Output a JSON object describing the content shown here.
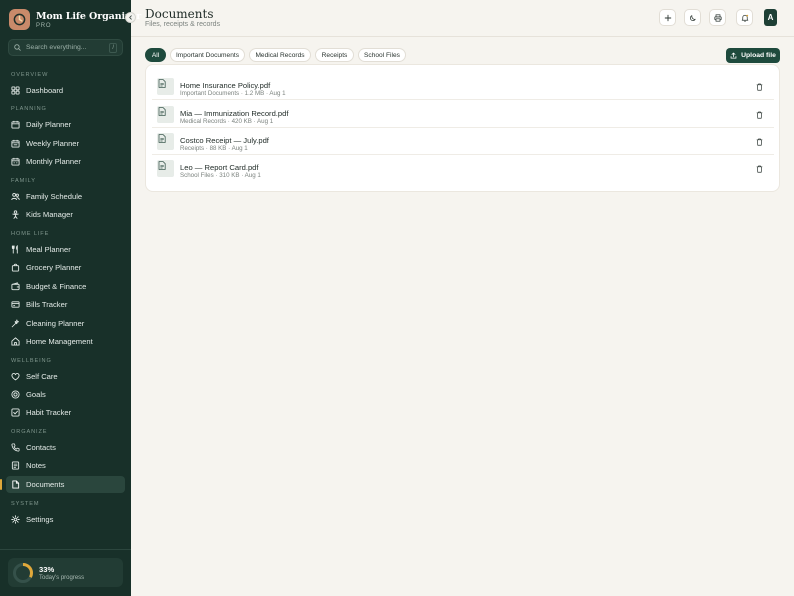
{
  "sidebar": {
    "brand_name": "Mom Life Organizer",
    "brand_tag": "PRO",
    "search_placeholder": "Search everything...",
    "search_shortcut": "/",
    "sections": {
      "overview": "OVERVIEW",
      "planning": "PLANNING",
      "family": "FAMILY",
      "home_life": "HOME LIFE",
      "wellbeing": "WELLBEING",
      "organize": "ORGANIZE",
      "system": "SYSTEM"
    },
    "items": {
      "dashboard": "Dashboard",
      "daily_planner": "Daily Planner",
      "weekly_planner": "Weekly Planner",
      "monthly_planner": "Monthly Planner",
      "family_schedule": "Family Schedule",
      "kids_manager": "Kids Manager",
      "meal_planner": "Meal Planner",
      "grocery_planner": "Grocery Planner",
      "budget_finance": "Budget & Finance",
      "bills_tracker": "Bills Tracker",
      "cleaning_planner": "Cleaning Planner",
      "home_management": "Home Management",
      "self_care": "Self Care",
      "goals": "Goals",
      "habit_tracker": "Habit Tracker",
      "contacts": "Contacts",
      "notes": "Notes",
      "documents": "Documents",
      "settings": "Settings"
    },
    "active_item": "documents",
    "progress": {
      "value": "33%",
      "fraction": 0.33,
      "label": "Today's progress"
    }
  },
  "header": {
    "title": "Documents",
    "subtitle": "Files, receipts & records",
    "avatar_initial": "A"
  },
  "tabs": [
    "All",
    "Important Documents",
    "Medical Records",
    "Receipts",
    "School Files"
  ],
  "active_tab": "All",
  "upload_label": "Upload file",
  "documents": [
    {
      "name": "Home Insurance Policy.pdf",
      "meta": "Important Documents · 1.2 MB · Aug 1"
    },
    {
      "name": "Mia — Immunization Record.pdf",
      "meta": "Medical Records · 420 KB · Aug 1"
    },
    {
      "name": "Costco Receipt — July.pdf",
      "meta": "Receipts · 88 KB · Aug 1"
    },
    {
      "name": "Leo — Report Card.pdf",
      "meta": "School Files · 310 KB · Aug 1"
    }
  ],
  "colors": {
    "sidebar_bg": "#183029",
    "accent": "#1e4a3d",
    "progress_ring": "#e0a83a",
    "page_bg": "#f6f4ef"
  }
}
